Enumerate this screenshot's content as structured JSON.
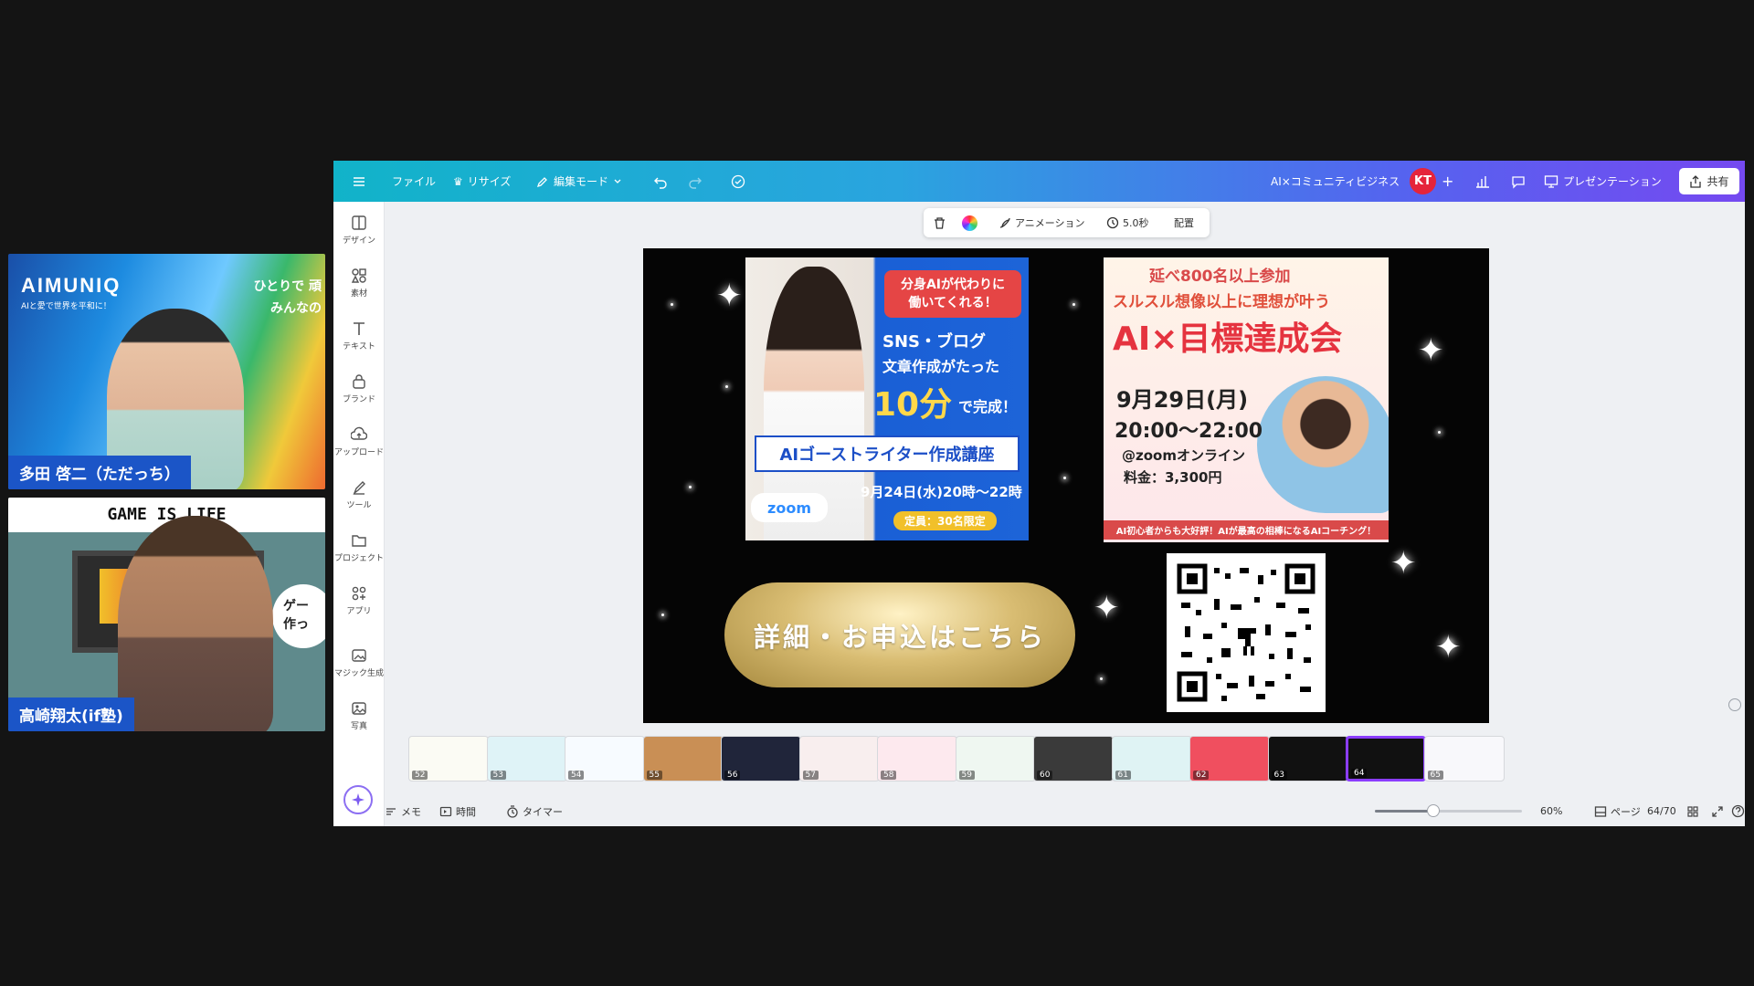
{
  "participants": [
    {
      "name": "多田 啓二（ただっち）",
      "brand": "AIMUNIQ",
      "brand_sub": "AIと愛で世界を平和に！",
      "tagline": "ひとりで 頑\nみんなの"
    },
    {
      "name": "高崎翔太(if塾)",
      "banner": "GAME IS LIFE",
      "bubble": "ゲー\n作っ"
    }
  ],
  "toolbar": {
    "file": "ファイル",
    "resize": "リサイズ",
    "edit_mode": "編集モード",
    "project_title": "AI×コミュニティビジネス",
    "avatar": "KT",
    "present": "プレゼンテーション",
    "share": "共有"
  },
  "sidebar": [
    {
      "label": "デザイン",
      "icon": "design-icon"
    },
    {
      "label": "素材",
      "icon": "elements-icon"
    },
    {
      "label": "テキスト",
      "icon": "text-icon"
    },
    {
      "label": "ブランド",
      "icon": "brand-icon"
    },
    {
      "label": "アップロード",
      "icon": "upload-icon"
    },
    {
      "label": "ツール",
      "icon": "draw-icon"
    },
    {
      "label": "プロジェクト",
      "icon": "folder-icon"
    },
    {
      "label": "アプリ",
      "icon": "apps-icon"
    },
    {
      "label": "マジック生成",
      "icon": "magic-media-icon"
    },
    {
      "label": "写真",
      "icon": "photo-icon"
    }
  ],
  "element_toolbar": {
    "animation": "アニメーション",
    "duration": "5.0秒",
    "position": "配置"
  },
  "slide": {
    "flyer1": {
      "badge": "分身AIが代わりに\n働いてくれる！",
      "line1": "SNS・ブログ",
      "line2": "文章作成がたった",
      "big_num": "10分",
      "line3": "で完成！",
      "course": "AIゴーストライター作成講座",
      "date": "9月24日(水)20時〜22時",
      "limit": "定員：30名限定",
      "zoom": "zoom"
    },
    "flyer2": {
      "top": "延べ800名以上参加",
      "sub": "スルスル想像以上に理想が叶う",
      "title": "AI×目標達成会",
      "date": "9月29日(月)",
      "time": "20:00〜22:00",
      "place": "@zoomオンライン",
      "fee": "料金：3,300円",
      "footer": "AI初心者からも大好評！AIが最高の相棒になるAIコーチング！"
    },
    "cta": "詳細・お申込はこちら"
  },
  "thumbnails": [
    {
      "num": "52",
      "color": "#fbfbf4"
    },
    {
      "num": "53",
      "color": "#dff3f7"
    },
    {
      "num": "54",
      "color": "#f7fbff"
    },
    {
      "num": "55",
      "color": "#c98f55"
    },
    {
      "num": "56",
      "color": "#20253a"
    },
    {
      "num": "57",
      "color": "#f8eeee"
    },
    {
      "num": "58",
      "color": "#fde9ee"
    },
    {
      "num": "59",
      "color": "#eff7f1"
    },
    {
      "num": "60",
      "color": "#3a3a3a"
    },
    {
      "num": "61",
      "color": "#dff3f4"
    },
    {
      "num": "62",
      "color": "#f04f5f"
    },
    {
      "num": "63",
      "color": "#111111"
    },
    {
      "num": "64",
      "color": "#111111"
    },
    {
      "num": "65",
      "color": "#f8f8fb"
    }
  ],
  "bottombar": {
    "notes": "メモ",
    "duration": "時間",
    "timer": "タイマー",
    "zoom": "60%",
    "zoom_fraction": 0.4,
    "pages_label": "ページ",
    "page_counter": "64/70"
  }
}
